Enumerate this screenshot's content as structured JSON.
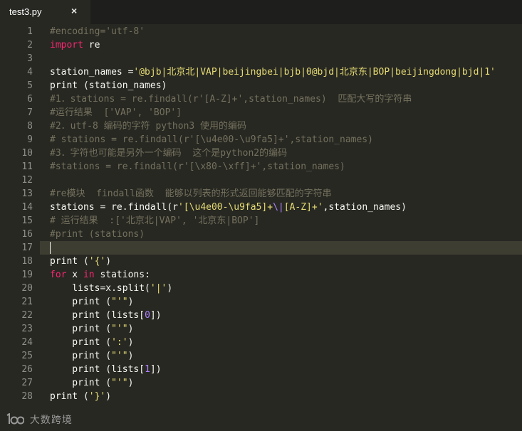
{
  "tab": {
    "title": "test3.py",
    "close_icon": "×"
  },
  "lines": [
    {
      "n": "1",
      "tokens": [
        [
          "c",
          "#encoding='utf-8'"
        ]
      ]
    },
    {
      "n": "2",
      "tokens": [
        [
          "k",
          "import"
        ],
        [
          "p",
          " re"
        ]
      ]
    },
    {
      "n": "3",
      "tokens": []
    },
    {
      "n": "4",
      "tokens": [
        [
          "p",
          "station_names ="
        ],
        [
          "s",
          "'@bjb|北京北|VAP|beijingbei|bjb|0@bjd|北京东|BOP|beijingdong|bjd|1'"
        ]
      ]
    },
    {
      "n": "5",
      "tokens": [
        [
          "p",
          "print (station_names)"
        ]
      ]
    },
    {
      "n": "6",
      "tokens": [
        [
          "c",
          "#1．stations = re.findall(r'[A-Z]+',station_names)  匹配大写的字符串"
        ]
      ]
    },
    {
      "n": "7",
      "tokens": [
        [
          "c",
          "#运行结果  ['VAP', 'BOP']"
        ]
      ]
    },
    {
      "n": "8",
      "tokens": [
        [
          "c",
          "#2．utf-8 编码的字符 python3 使用的编码"
        ]
      ]
    },
    {
      "n": "9",
      "tokens": [
        [
          "c",
          "# stations = re.findall(r'[\\u4e00-\\u9fa5]+',station_names)"
        ]
      ]
    },
    {
      "n": "10",
      "tokens": [
        [
          "c",
          "#3．字符也可能是另外一个编码  这个是python2的编码"
        ]
      ]
    },
    {
      "n": "11",
      "tokens": [
        [
          "c",
          "#stations = re.findall(r'[\\x80-\\xff]+',station_names)"
        ]
      ]
    },
    {
      "n": "12",
      "tokens": []
    },
    {
      "n": "13",
      "tokens": [
        [
          "c",
          "#re模块  findall函数  能够以列表的形式返回能够匹配的字符串"
        ]
      ]
    },
    {
      "n": "14",
      "tokens": [
        [
          "p",
          "stations = re.findall(r"
        ],
        [
          "s",
          "'[\\u4e00-\\u9fa5]+"
        ],
        [
          "e",
          "\\|"
        ],
        [
          "s",
          "[A-Z]+'"
        ],
        [
          "p",
          ",station_names)"
        ]
      ]
    },
    {
      "n": "15",
      "tokens": [
        [
          "c",
          "# 运行结果  :['北京北|VAP', '北京东|BOP']"
        ]
      ]
    },
    {
      "n": "16",
      "tokens": [
        [
          "c",
          "#print (stations)"
        ]
      ]
    },
    {
      "n": "17",
      "tokens": []
    },
    {
      "n": "18",
      "tokens": [
        [
          "p",
          "print ("
        ],
        [
          "s",
          "'{'"
        ],
        [
          "p",
          ")"
        ]
      ]
    },
    {
      "n": "19",
      "tokens": [
        [
          "k",
          "for"
        ],
        [
          "p",
          " x "
        ],
        [
          "k",
          "in"
        ],
        [
          "p",
          " stations:"
        ]
      ]
    },
    {
      "n": "20",
      "tokens": [
        [
          "p",
          "    lists=x.split("
        ],
        [
          "s",
          "'|'"
        ],
        [
          "p",
          ")"
        ]
      ]
    },
    {
      "n": "21",
      "tokens": [
        [
          "p",
          "    print ("
        ],
        [
          "s",
          "\"'\""
        ],
        [
          "p",
          ")"
        ]
      ]
    },
    {
      "n": "22",
      "tokens": [
        [
          "p",
          "    print (lists["
        ],
        [
          "e",
          "0"
        ],
        [
          "p",
          "])"
        ]
      ]
    },
    {
      "n": "23",
      "tokens": [
        [
          "p",
          "    print ("
        ],
        [
          "s",
          "\"'\""
        ],
        [
          "p",
          ")"
        ]
      ]
    },
    {
      "n": "24",
      "tokens": [
        [
          "p",
          "    print ("
        ],
        [
          "s",
          "':'"
        ],
        [
          "p",
          ")"
        ]
      ]
    },
    {
      "n": "25",
      "tokens": [
        [
          "p",
          "    print ("
        ],
        [
          "s",
          "\"'\""
        ],
        [
          "p",
          ")"
        ]
      ]
    },
    {
      "n": "26",
      "tokens": [
        [
          "p",
          "    print (lists["
        ],
        [
          "e",
          "1"
        ],
        [
          "p",
          "])"
        ]
      ]
    },
    {
      "n": "27",
      "tokens": [
        [
          "p",
          "    print ("
        ],
        [
          "s",
          "\"'\""
        ],
        [
          "p",
          ")"
        ]
      ]
    },
    {
      "n": "28",
      "tokens": [
        [
          "p",
          "print ("
        ],
        [
          "s",
          "'}'"
        ],
        [
          "p",
          ")"
        ]
      ]
    }
  ],
  "current_line": "17",
  "watermark": {
    "text": "大数跨境"
  },
  "colors": {
    "background": "#272822",
    "comment": "#75715e",
    "keyword": "#f92672",
    "string": "#e6db74",
    "number": "#ae81ff"
  }
}
